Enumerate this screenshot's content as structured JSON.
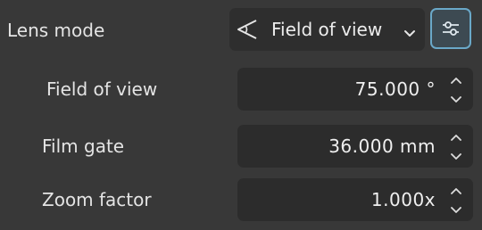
{
  "lens_mode": {
    "label": "Lens mode",
    "value": "Field of view",
    "icon": "angle-icon",
    "options_icon": "sliders-icon"
  },
  "fields": [
    {
      "label": "Field of view",
      "value": "75.000 °"
    },
    {
      "label": "Film gate",
      "value": "36.000 mm"
    },
    {
      "label": "Zoom factor",
      "value": "1.000x"
    }
  ],
  "colors": {
    "background": "#383838",
    "field": "#2c2c2c",
    "accent_border": "#6aa8c8"
  }
}
